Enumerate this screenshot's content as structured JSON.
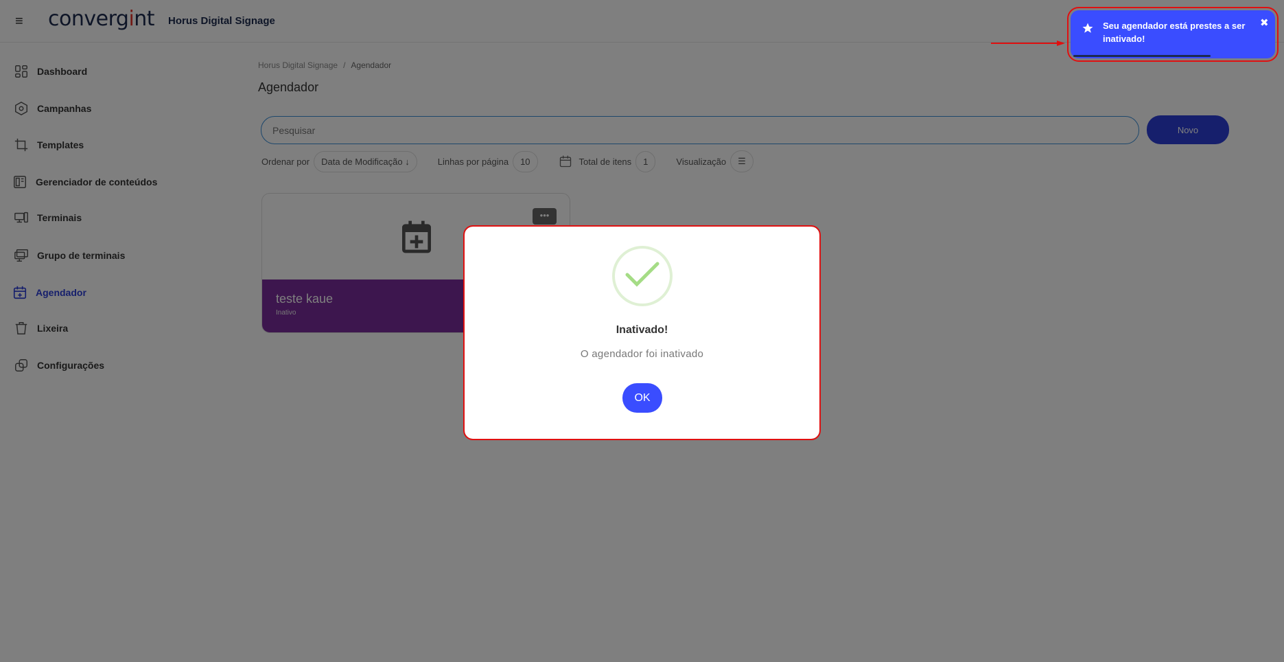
{
  "header": {
    "menu_icon": "hamburger-icon",
    "logo_part1": "converg",
    "logo_part2": "i",
    "logo_part3": "nt",
    "app_name": "Horus Digital Signage"
  },
  "sidebar": {
    "items": [
      {
        "label": "Dashboard",
        "icon": "dashboard-icon"
      },
      {
        "label": "Campanhas",
        "icon": "campaign-icon"
      },
      {
        "label": "Templates",
        "icon": "crop-icon"
      },
      {
        "label": "Gerenciador de conteúdos",
        "icon": "content-icon"
      },
      {
        "label": "Terminais",
        "icon": "terminal-icon"
      },
      {
        "label": "Grupo de terminais",
        "icon": "monitors-icon"
      },
      {
        "label": "Agendador",
        "icon": "calendar-plus-icon",
        "active": true
      },
      {
        "label": "Lixeira",
        "icon": "trash-icon"
      },
      {
        "label": "Configurações",
        "icon": "settings-icon"
      }
    ]
  },
  "breadcrumb": {
    "root": "Horus Digital Signage",
    "separator": "/",
    "current": "Agendador"
  },
  "page_title": "Agendador",
  "search": {
    "placeholder": "Pesquisar"
  },
  "new_button": "Novo",
  "filters": {
    "order_label": "Ordenar por",
    "order_value": "Data de Modificação ↓",
    "lines_label": "Linhas por página",
    "lines_value": "10",
    "total_label": "Total de itens",
    "total_value": "1",
    "view_label": "Visualização"
  },
  "card": {
    "title": "teste kaue",
    "status": "Inativo",
    "menu": "•••"
  },
  "modal": {
    "title": "Inativado!",
    "text": "O agendador foi inativado",
    "ok": "OK"
  },
  "toast": {
    "text": "Seu agendador está prestes a ser inativado!",
    "close": "✖"
  },
  "colors": {
    "accent": "#2d3fd8",
    "toast": "#3a4dff",
    "card_footer": "#7a2d9c",
    "highlight": "#e01010"
  }
}
